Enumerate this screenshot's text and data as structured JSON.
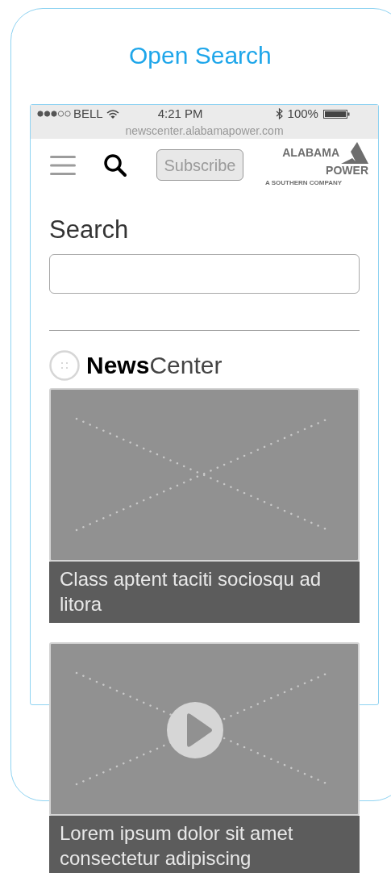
{
  "step": {
    "title": "Open Search"
  },
  "status_bar": {
    "carrier": "BELL",
    "time": "4:21 PM",
    "battery": "100%"
  },
  "address_bar": {
    "url": "newscenter.alabamapower.com"
  },
  "header": {
    "subscribe_button": "Subscribe",
    "logo": {
      "name_line_1": "ALABAMA",
      "name_line_2": "POWER",
      "tagline": "A SOUTHERN COMPANY"
    }
  },
  "search": {
    "label": "Search"
  },
  "section_logo": {
    "text": "**News**Center"
  },
  "articles": [
    {
      "kind": "image",
      "caption": "Class aptent taciti sociosqu ad litora"
    },
    {
      "kind": "video",
      "caption": "Lorem ipsum dolor sit amet consectetur adipiscing"
    }
  ]
}
